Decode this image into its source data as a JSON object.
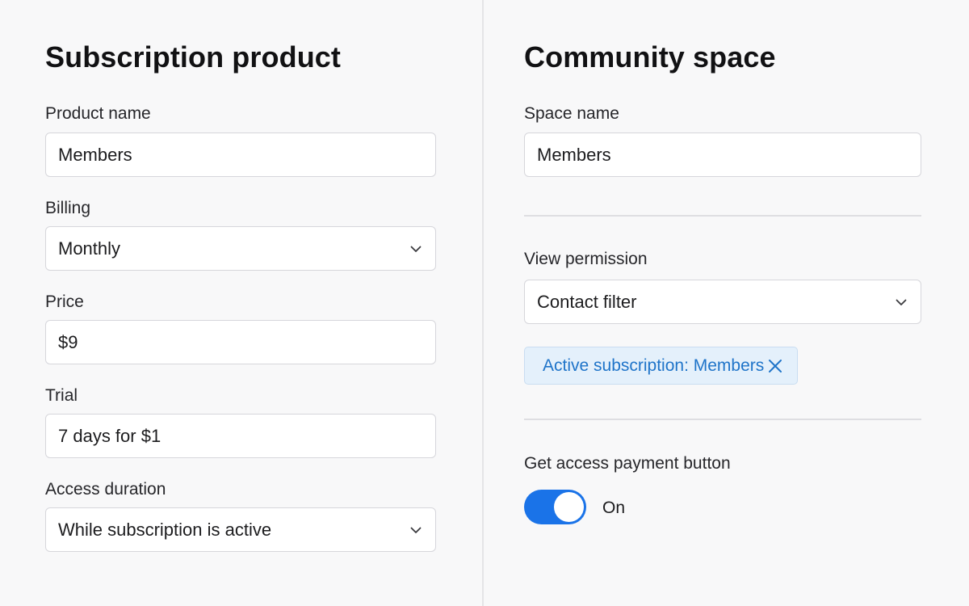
{
  "subscription_product": {
    "title": "Subscription product",
    "product_name": {
      "label": "Product name",
      "value": "Members"
    },
    "billing": {
      "label": "Billing",
      "value": "Monthly"
    },
    "price": {
      "label": "Price",
      "value": "$9"
    },
    "trial": {
      "label": "Trial",
      "value": "7 days for $1"
    },
    "access_duration": {
      "label": "Access duration",
      "value": "While subscription is active"
    }
  },
  "community_space": {
    "title": "Community space",
    "space_name": {
      "label": "Space name",
      "value": "Members"
    },
    "view_permission": {
      "label": "View permission",
      "value": "Contact filter",
      "filter_chip": "Active subscription: Members"
    },
    "payment_button": {
      "label": "Get access payment button",
      "state": "On",
      "enabled": true
    }
  },
  "colors": {
    "accent": "#1a73e8",
    "chip_bg": "#e4f0fb",
    "chip_text": "#1f74c9",
    "border": "#d6d6db"
  },
  "icons": {
    "dropdown": "chevron-down-icon",
    "remove": "close-icon"
  }
}
